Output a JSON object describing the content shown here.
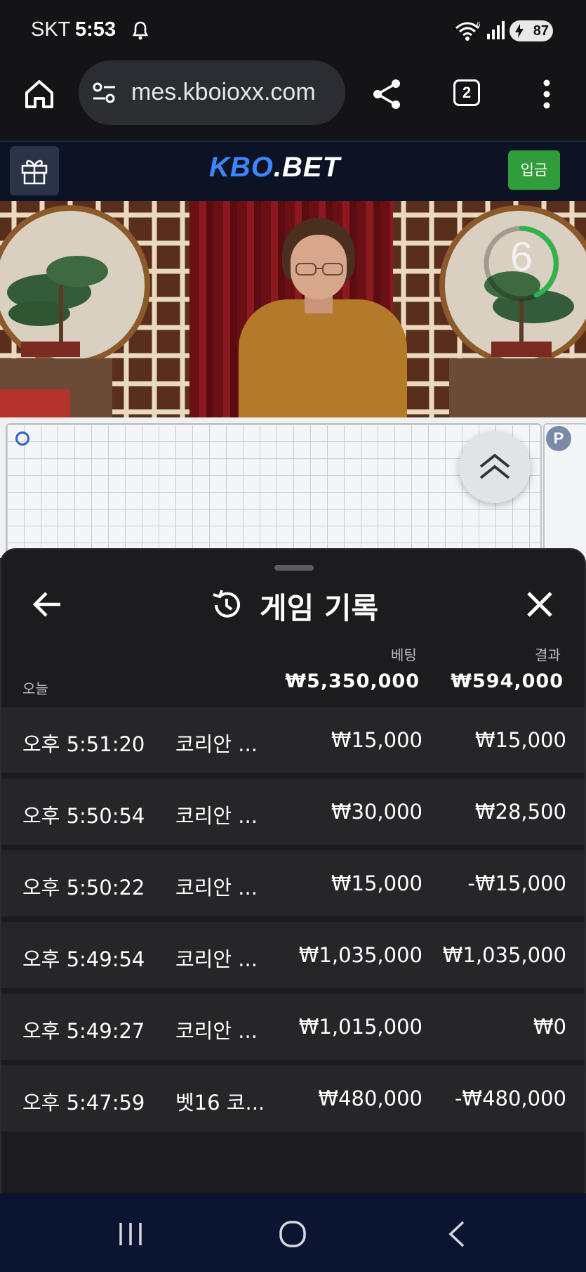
{
  "status_bar": {
    "carrier": "SKT",
    "time": "5:53",
    "battery": "87",
    "icons": [
      "dnd-icon",
      "wifi-icon",
      "signal-icon",
      "battery-icon"
    ]
  },
  "browser": {
    "url": "mes.kboioxx.com",
    "tab_count": "2",
    "icons": [
      "home-icon",
      "site-settings-icon",
      "share-icon",
      "tabs-icon",
      "overflow-menu-icon"
    ]
  },
  "site": {
    "logo_kbo": "KBO",
    "logo_bet": ".BET",
    "deposit_label": "입금",
    "brand_color": "#3d86ff",
    "deposit_color": "#2f9e3a"
  },
  "video": {
    "countdown": "6"
  },
  "roadmap": {
    "player_badge": "P"
  },
  "history": {
    "title": "게임 기록",
    "col_bet": "베팅",
    "col_result": "결과",
    "today_label": "오늘",
    "total_bet": "₩5,350,000",
    "total_result": "₩594,000",
    "rows": [
      {
        "time": "오후 5:51:20",
        "game": "코리안 ...",
        "bet": "₩15,000",
        "result": "₩15,000"
      },
      {
        "time": "오후 5:50:54",
        "game": "코리안 ...",
        "bet": "₩30,000",
        "result": "₩28,500"
      },
      {
        "time": "오후 5:50:22",
        "game": "코리안 ...",
        "bet": "₩15,000",
        "result": "-₩15,000"
      },
      {
        "time": "오후 5:49:54",
        "game": "코리안 ...",
        "bet": "₩1,035,000",
        "result": "₩1,035,000"
      },
      {
        "time": "오후 5:49:27",
        "game": "코리안 ...",
        "bet": "₩1,015,000",
        "result": "₩0"
      },
      {
        "time": "오후 5:47:59",
        "game": "벳16 코...",
        "bet": "₩480,000",
        "result": "-₩480,000"
      }
    ]
  }
}
